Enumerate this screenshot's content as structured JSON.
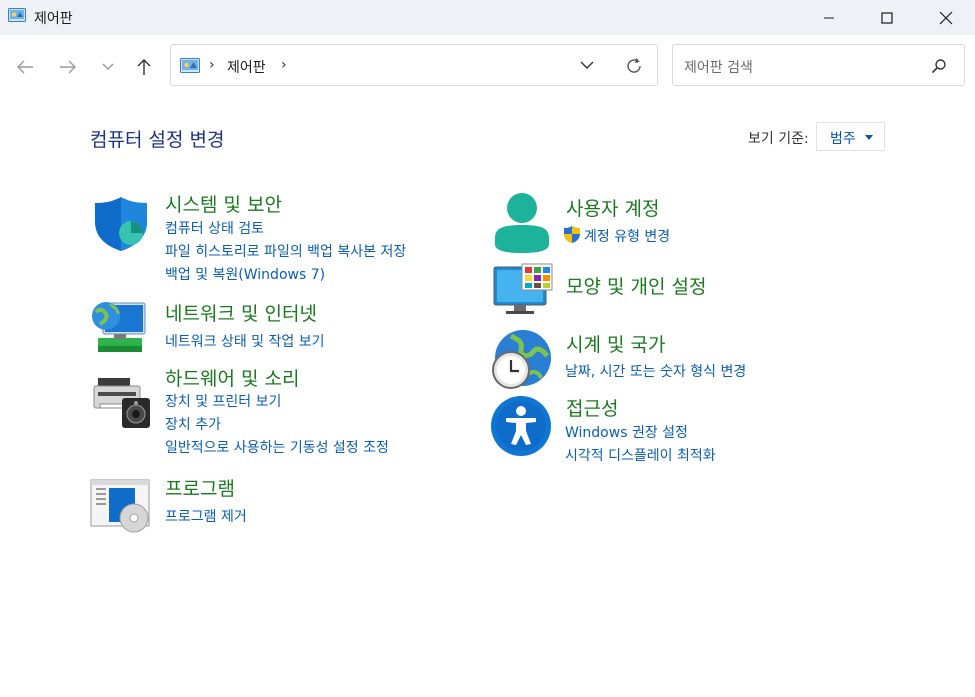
{
  "window": {
    "title": "제어판",
    "minimize_label": "",
    "maximize_label": "",
    "close_label": ""
  },
  "address_bar": {
    "crumbs": [
      "제어판"
    ],
    "separator": "›"
  },
  "search": {
    "placeholder": "제어판 검색"
  },
  "page": {
    "heading": "컴퓨터 설정 변경",
    "view_by_label": "보기 기준:",
    "view_by_value": "범주"
  },
  "categories": [
    {
      "title": "시스템 및 보안",
      "icon": "shield-icon",
      "links": [
        "컴퓨터 상태 검토",
        "파일 히스토리로 파일의 백업 복사본 저장",
        "백업 및 복원(Windows 7)"
      ]
    },
    {
      "title": "네트워크 및 인터넷",
      "icon": "network-globe-icon",
      "links": [
        "네트워크 상태 및 작업 보기"
      ]
    },
    {
      "title": "하드웨어 및 소리",
      "icon": "printer-speaker-icon",
      "links": [
        "장치 및 프린터 보기",
        "장치 추가",
        "일반적으로 사용하는 기동성 설정 조정"
      ]
    },
    {
      "title": "프로그램",
      "icon": "programs-icon",
      "links": [
        "프로그램 제거"
      ]
    },
    {
      "title": "사용자 계정",
      "icon": "user-accounts-icon",
      "links": [
        "계정 유형 변경"
      ],
      "link_icon": "uac-shield-icon"
    },
    {
      "title": "모양 및 개인 설정",
      "icon": "appearance-monitor-icon",
      "links": []
    },
    {
      "title": "시계 및 국가",
      "icon": "clock-globe-icon",
      "links": [
        "날짜, 시간 또는 숫자 형식 변경"
      ]
    },
    {
      "title": "접근성",
      "icon": "accessibility-icon",
      "links": [
        "Windows 권장 설정",
        "시각적 디스플레이 최적화"
      ]
    }
  ],
  "colors": {
    "titlebar_bg": "#eef1f6",
    "heading": "#1e3287",
    "category_title": "#1a7a1f",
    "link": "#0b5fb0"
  }
}
